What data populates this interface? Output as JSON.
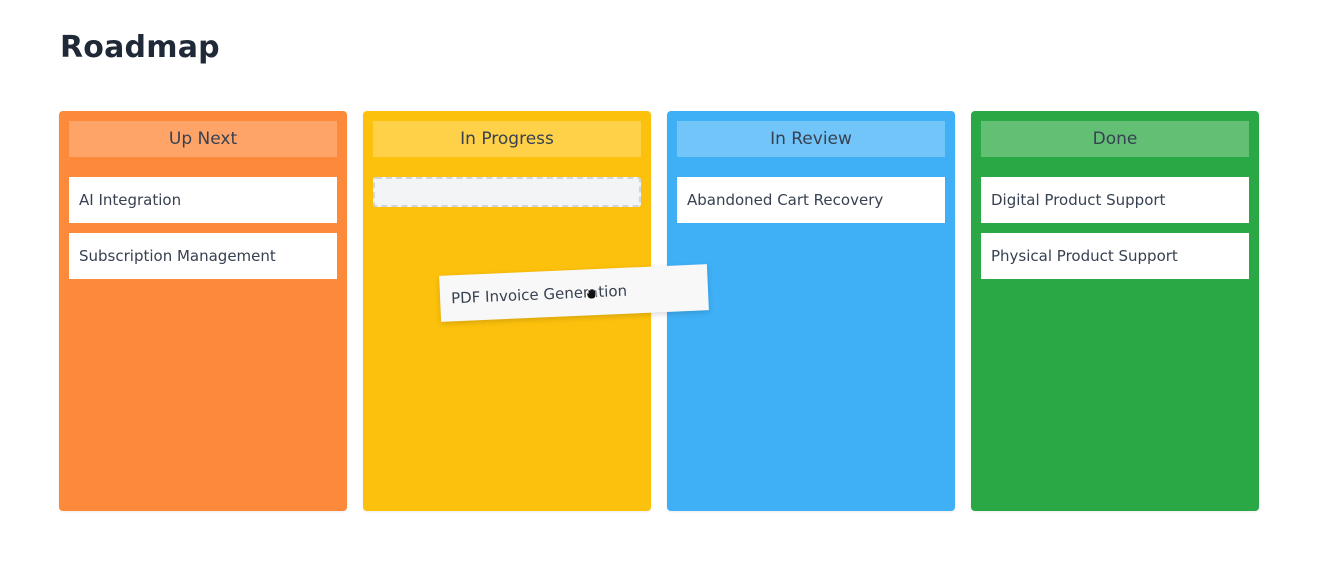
{
  "page": {
    "title": "Roadmap"
  },
  "columns": [
    {
      "title": "Up Next",
      "color": "#fd8a3b",
      "header_color": "#ffa469",
      "cards": [
        "AI Integration",
        "Subscription Management"
      ]
    },
    {
      "title": "In Progress",
      "color": "#fcc10c",
      "header_color": "#ffd148",
      "cards": []
    },
    {
      "title": "In Review",
      "color": "#3fb0f6",
      "header_color": "#72c5f9",
      "cards": [
        "Abandoned Cart Recovery"
      ]
    },
    {
      "title": "Done",
      "color": "#2aa845",
      "header_color": "#62bf74",
      "cards": [
        "Digital Product Support",
        "Physical Product Support"
      ]
    }
  ],
  "dragging": {
    "label": "PDF Invoice Generation",
    "target_column": "In Progress"
  },
  "cursor": {
    "icon": "grab-hand-icon"
  }
}
